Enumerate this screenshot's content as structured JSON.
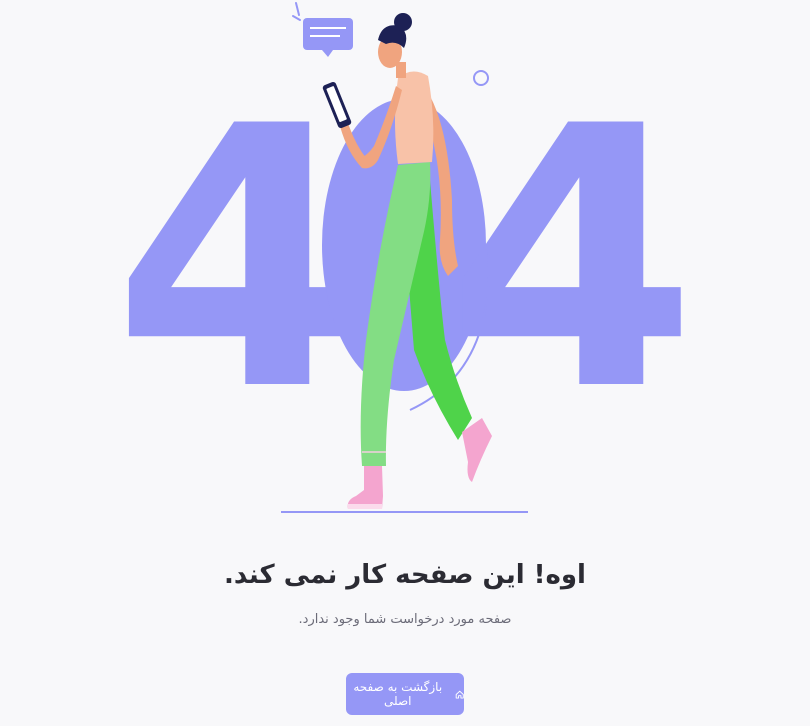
{
  "illustration": {
    "digits": [
      "4",
      "0",
      "4"
    ],
    "accent_color": "#9597f6"
  },
  "message": {
    "title": "اوه! این صفحه کار نمی کند.",
    "subtitle": "صفحه مورد درخواست شما وجود ندارد."
  },
  "actions": {
    "home_button_label": "بازگشت به صفحه اصلی",
    "home_button_icon": "home-icon"
  }
}
